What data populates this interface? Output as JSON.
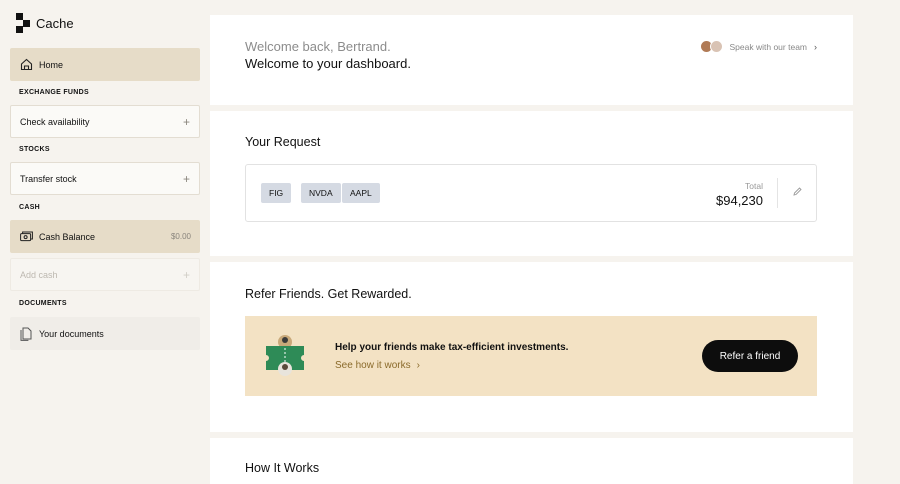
{
  "app": {
    "name": "Cache"
  },
  "sidebar": {
    "home": "Home",
    "sections": {
      "exchange_funds": "EXCHANGE FUNDS",
      "stocks": "STOCKS",
      "cash": "CASH",
      "documents": "DOCUMENTS"
    },
    "check_availability": "Check availability",
    "transfer_stock": "Transfer stock",
    "cash_balance": {
      "label": "Cash Balance",
      "value": "$0.00"
    },
    "add_cash": "Add cash",
    "your_documents": "Your documents"
  },
  "welcome": {
    "line1": "Welcome back, Bertrand.",
    "line2": "Welcome to your dashboard.",
    "team_link": "Speak with our team"
  },
  "request": {
    "title": "Your Request",
    "tags": [
      "FIG",
      "NVDA",
      "AAPL"
    ],
    "total_label": "Total",
    "total_value": "$94,230"
  },
  "refer": {
    "title": "Refer Friends. Get Rewarded.",
    "headline": "Help your friends make tax-efficient investments.",
    "link": "See how it works",
    "button": "Refer a friend"
  },
  "how": {
    "title": "How It Works"
  },
  "colors": {
    "accent_beige": "#e6dcc8",
    "refer_bg": "#f3e2c4",
    "tag_bg": "#d5dae3",
    "link": "#8a6a2a"
  },
  "icons": [
    "home-icon",
    "plus-icon",
    "cash-icon",
    "documents-icon",
    "chevron-right-icon",
    "pencil-icon",
    "ticket-illustration"
  ]
}
